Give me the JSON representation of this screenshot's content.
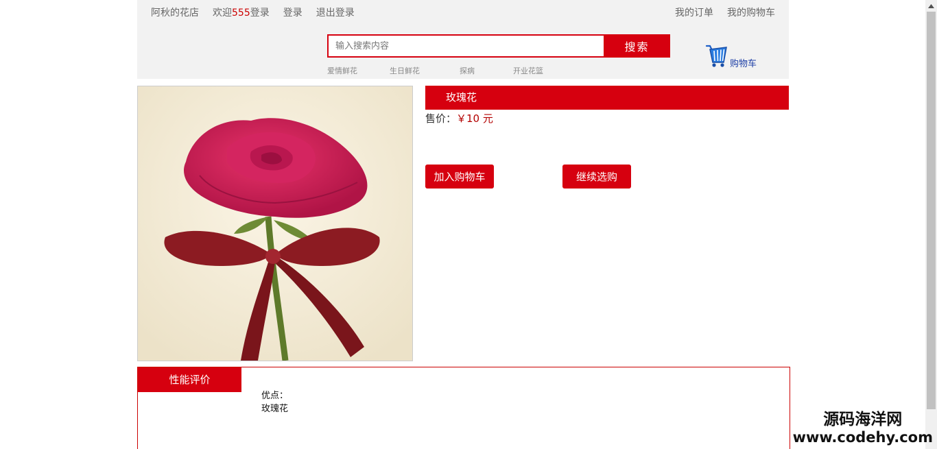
{
  "topnav": {
    "shop_name": "阿秋的花店",
    "welcome_prefix": "欢迎",
    "username": "555",
    "welcome_suffix": "登录",
    "login": "登录",
    "logout": "退出登录",
    "my_orders": "我的订单",
    "my_cart": "我的购物车"
  },
  "search": {
    "placeholder": "输入搜索内容",
    "button_label": "搜索"
  },
  "hot_links": [
    "爱情鲜花",
    "生日鲜花",
    "探病",
    "开业花篮"
  ],
  "cart": {
    "icon": "shopping-basket-icon",
    "label": "购物车"
  },
  "product": {
    "name": "玫瑰花",
    "price_label": "售价：",
    "price": "￥10 元",
    "add_to_cart": "加入购物车",
    "continue_shopping": "继续选购"
  },
  "review": {
    "tab_label": "性能评价",
    "advantage_label": "优点：",
    "advantage_text": "玫瑰花"
  },
  "watermark": {
    "line1": "源码海洋网",
    "line2": "www.codehy.com"
  },
  "colors": {
    "accent": "#d6000f",
    "header_bg": "#f2f2f2",
    "cart_blue": "#1d3fa6"
  }
}
